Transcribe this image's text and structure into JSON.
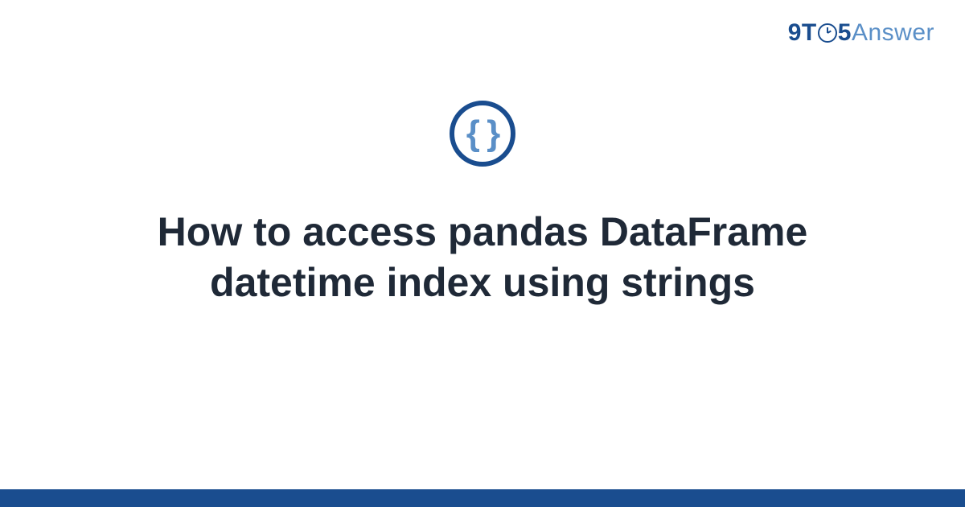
{
  "logo": {
    "part1": "9T",
    "part2": "5",
    "part3": "Answer"
  },
  "icon": {
    "name": "code-braces-icon",
    "glyph": "{ }"
  },
  "title": "How to access pandas DataFrame datetime index using strings",
  "colors": {
    "primary": "#1a4d8f",
    "secondary": "#5a8fc7",
    "text": "#1f2937"
  }
}
